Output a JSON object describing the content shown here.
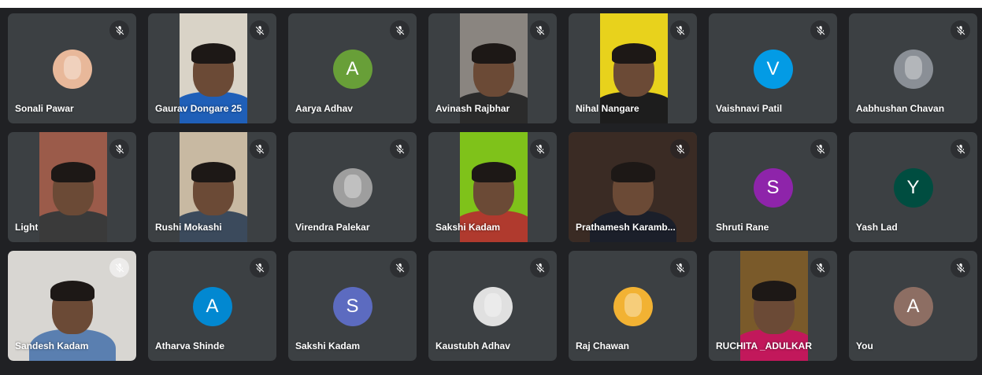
{
  "participants": [
    {
      "name": "Sonali Pawar",
      "type": "photo",
      "photo_color": "#e8b89a"
    },
    {
      "name": "Gaurav Dongare 25",
      "type": "video",
      "bg": "#d9d3c7",
      "shirt": "#1f5fb8"
    },
    {
      "name": "Aarya Adhav",
      "type": "initial",
      "initial": "A",
      "color": "#689f38"
    },
    {
      "name": "Avinash Rajbhar",
      "type": "video",
      "bg": "#8a8580",
      "shirt": "#2b2b2b"
    },
    {
      "name": "Nihal Nangare",
      "type": "video",
      "bg": "#e8d21c",
      "shirt": "#1d1d1d"
    },
    {
      "name": "Vaishnavi Patil",
      "type": "initial",
      "initial": "V",
      "color": "#039be5"
    },
    {
      "name": "Aabhushan Chavan",
      "type": "photo",
      "photo_color": "#8a8f96"
    },
    {
      "name": "Light",
      "type": "video",
      "bg": "#9b5b4a",
      "shirt": "#3a3a3a"
    },
    {
      "name": "Rushi Mokashi",
      "type": "video",
      "bg": "#c8b9a2",
      "shirt": "#3b4a5c"
    },
    {
      "name": "Virendra Palekar",
      "type": "photo",
      "photo_color": "#9e9e9e"
    },
    {
      "name": "Sakshi Kadam",
      "type": "video",
      "bg": "#7fc21a",
      "shirt": "#b03a2e"
    },
    {
      "name": "Prathamesh Karamb...",
      "type": "video_wide",
      "bg": "#3a2b24",
      "shirt": "#1b1f2a"
    },
    {
      "name": "Shruti Rane",
      "type": "initial",
      "initial": "S",
      "color": "#8e24aa"
    },
    {
      "name": "Yash Lad",
      "type": "initial",
      "initial": "Y",
      "color": "#004d40"
    },
    {
      "name": "Sandesh Kadam",
      "type": "video_wide",
      "bg": "#d8d6d2",
      "shirt": "#5a7fb0"
    },
    {
      "name": "Atharva Shinde",
      "type": "initial",
      "initial": "A",
      "color": "#0288d1"
    },
    {
      "name": "Sakshi Kadam",
      "type": "initial",
      "initial": "S",
      "color": "#5c6bc0"
    },
    {
      "name": "Kaustubh Adhav",
      "type": "photo",
      "photo_color": "#e0e0e0"
    },
    {
      "name": "Raj Chawan",
      "type": "photo",
      "photo_color": "#f2b233"
    },
    {
      "name": "RUCHITA _ADULKAR",
      "type": "video",
      "bg": "#7a5a2a",
      "shirt": "#c2185b"
    },
    {
      "name": "You",
      "type": "initial",
      "initial": "A",
      "color": "#8d6e63"
    }
  ]
}
